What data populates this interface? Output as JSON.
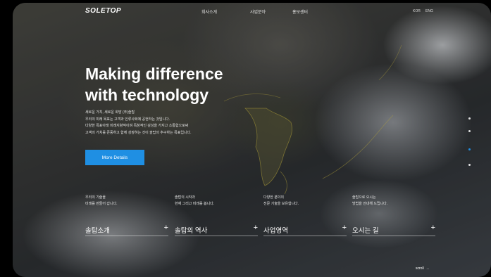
{
  "header": {
    "logo": "SOLETOP",
    "nav": [
      "회사소개",
      "사업분야",
      "홍보센터"
    ],
    "lang": [
      "KOR",
      "ENG"
    ]
  },
  "hero": {
    "title_line1": "Making difference",
    "title_line2": "with technology",
    "desc": [
      "새로운 가치, 새로운 희망 (주)솔탑",
      "우리의 미래 목표는 고객과 인류사회에 공헌하는 것입니다.",
      "다양한 목표아래 미래지향적이며 독창적인 감성을 가지고 소통함으로써",
      "고객의 가치를 존중하고 함께 성장하는 것이 솔탑의 추구하는 목표입니다."
    ],
    "button": "More Details"
  },
  "cards": [
    {
      "d1": "우리의 기술을",
      "d2": "미래를 만들어 갑니다.",
      "label": "솔탑소개"
    },
    {
      "d1": "솔탑의 시작과",
      "d2": "현재 그리고 미래를 봅니다.",
      "label": "솔탑의 역사"
    },
    {
      "d1": "다양한 분야의",
      "d2": "전문 기술을 보유합니다.",
      "label": "사업영역"
    },
    {
      "d1": "솔탑으로 오시는",
      "d2": "방법을 안내해 드립니다.",
      "label": "오시는 길"
    }
  ],
  "scroll": "scroll",
  "colors": {
    "accent": "#1f8fe3"
  }
}
